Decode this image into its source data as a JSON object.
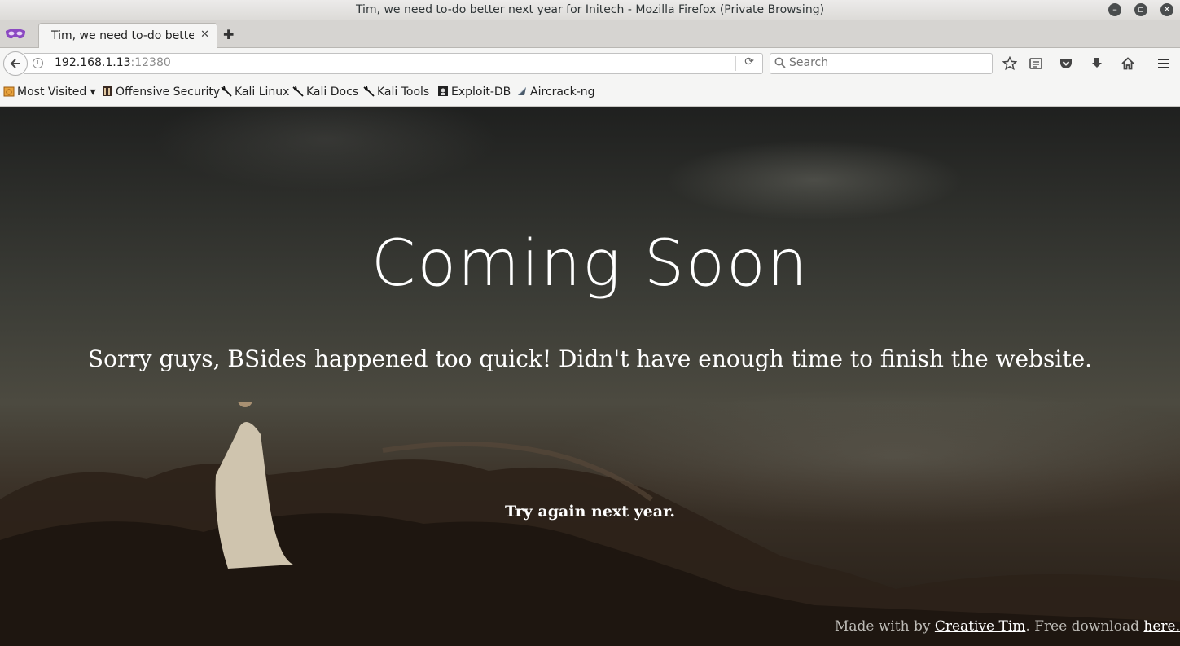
{
  "window": {
    "title": "Tim, we need to-do better next year for Initech - Mozilla Firefox (Private Browsing)"
  },
  "tab": {
    "title": "Tim, we need to-do bette…"
  },
  "urlbar": {
    "host": "192.168.1.13",
    "port": ":12380"
  },
  "search": {
    "placeholder": "Search"
  },
  "bookmarks": [
    {
      "label": "Most Visited ▾",
      "icon": "most-visited-icon"
    },
    {
      "label": "Offensive Security",
      "icon": "offsec-icon"
    },
    {
      "label": "Kali Linux",
      "icon": "kali-dragon-icon"
    },
    {
      "label": "Kali Docs",
      "icon": "kali-dragon-icon"
    },
    {
      "label": "Kali Tools",
      "icon": "kali-dragon-icon"
    },
    {
      "label": "Exploit-DB",
      "icon": "exploit-db-icon"
    },
    {
      "label": "Aircrack-ng",
      "icon": "aircrack-icon"
    }
  ],
  "page": {
    "title": "Coming Soon",
    "subtitle": "Sorry guys, BSides happened too quick! Didn't have enough time to finish the website.",
    "tagline": "Try again next year.",
    "footer_prefix": "Made with by ",
    "footer_link1": "Creative Tim",
    "footer_middle": ". Free download ",
    "footer_link2": "here."
  }
}
